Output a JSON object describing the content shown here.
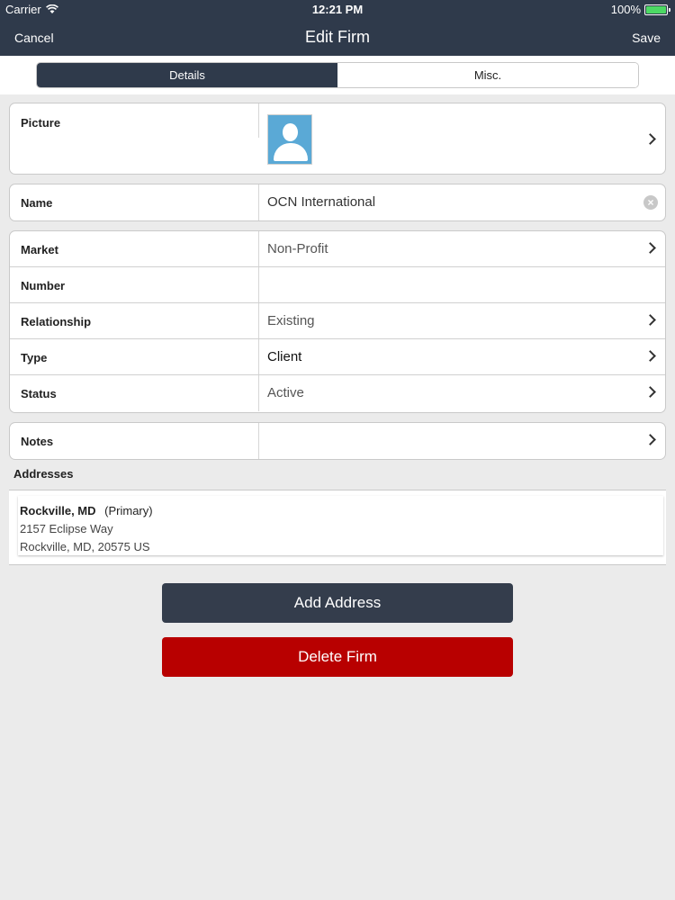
{
  "status_bar": {
    "carrier": "Carrier",
    "time": "12:21 PM",
    "battery": "100%"
  },
  "nav": {
    "cancel": "Cancel",
    "title": "Edit Firm",
    "save": "Save"
  },
  "tabs": {
    "details": "Details",
    "misc": "Misc."
  },
  "picture": {
    "label": "Picture"
  },
  "name": {
    "label": "Name",
    "value": "OCN International"
  },
  "fields": {
    "market": {
      "label": "Market",
      "value": "Non-Profit"
    },
    "number": {
      "label": "Number",
      "value": ""
    },
    "relationship": {
      "label": "Relationship",
      "value": "Existing"
    },
    "type": {
      "label": "Type",
      "value": "Client"
    },
    "status": {
      "label": "Status",
      "value": "Active"
    }
  },
  "notes": {
    "label": "Notes"
  },
  "addresses": {
    "header": "Addresses",
    "items": [
      {
        "city": "Rockville, MD",
        "tag": "(Primary)",
        "street": "2157 Eclipse Way",
        "city_line": "Rockville, MD, 20575 US"
      }
    ]
  },
  "buttons": {
    "add_address": "Add Address",
    "delete_firm": "Delete Firm"
  },
  "colors": {
    "header": "#2f3a4b",
    "delete": "#b80000",
    "battery": "#4cd964",
    "avatar": "#5aa9d6"
  }
}
